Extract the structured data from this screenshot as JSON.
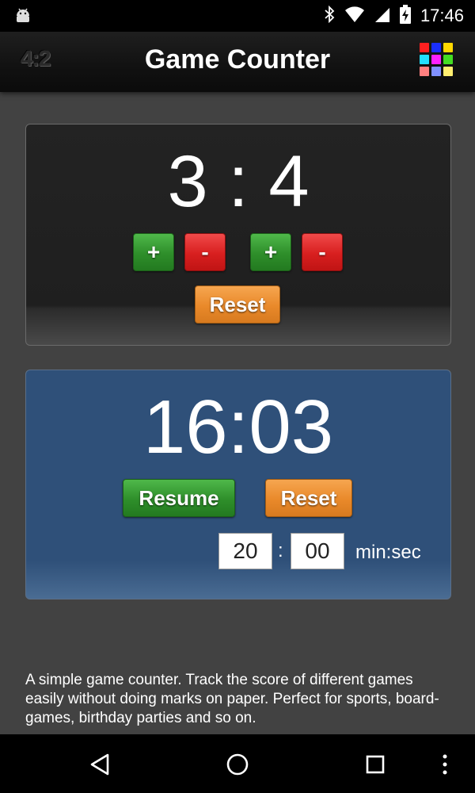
{
  "status_bar": {
    "time": "17:46",
    "icons": [
      "android-debug-icon",
      "bluetooth-icon",
      "wifi-icon",
      "signal-icon",
      "battery-charging-icon"
    ]
  },
  "action_bar": {
    "logo_text": "4:2",
    "title": "Game Counter",
    "menu_icon": "color-grid-icon",
    "grid_colors": [
      "#ff2020",
      "#1a2fff",
      "#ffd800",
      "#22e0ff",
      "#ff20ff",
      "#44dd22",
      "#ff8080",
      "#8090ff",
      "#ffee70"
    ]
  },
  "score_panel": {
    "score_left": "3",
    "separator": ":",
    "score_right": "4",
    "plus_label": "+",
    "minus_label": "-",
    "reset_label": "Reset"
  },
  "timer_panel": {
    "display": "16:03",
    "resume_label": "Resume",
    "reset_label": "Reset",
    "minutes_value": "20",
    "seconds_value": "00",
    "separator": ":",
    "unit_label": "min:sec"
  },
  "description": "A simple game counter. Track the score of different games easily without doing marks on paper. Perfect for sports, board-games, birthday parties and so on.",
  "nav_bar": {
    "icons": [
      "back-icon",
      "home-icon",
      "recents-icon",
      "overflow-menu-icon"
    ]
  },
  "colors": {
    "background": "#424242",
    "timer_panel": "#2f5079",
    "green_button": "#2e8e2a",
    "red_button": "#d81f1f",
    "orange_button": "#e9892a"
  }
}
